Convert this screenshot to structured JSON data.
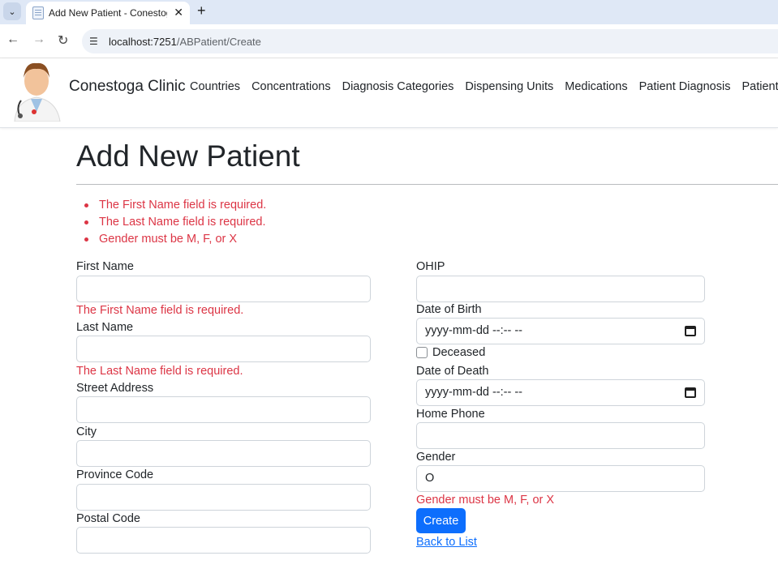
{
  "browser": {
    "tab_title": "Add New Patient - Conestoga C",
    "url_host": "localhost:7251",
    "url_path": "/ABPatient/Create"
  },
  "navbar": {
    "brand": "Conestoga Clinic",
    "links": [
      "Countries",
      "Concentrations",
      "Diagnosis Categories",
      "Dispensing Units",
      "Medications",
      "Patient Diagnosis",
      "Patients"
    ]
  },
  "page": {
    "title": "Add New Patient",
    "summary_errors": [
      "The First Name field is required.",
      "The Last Name field is required.",
      "Gender must be M, F, or X"
    ]
  },
  "form": {
    "first_name": {
      "label": "First Name",
      "value": "",
      "error": "The First Name field is required."
    },
    "last_name": {
      "label": "Last Name",
      "value": "",
      "error": "The Last Name field is required."
    },
    "street_address": {
      "label": "Street Address",
      "value": ""
    },
    "city": {
      "label": "City",
      "value": ""
    },
    "province_code": {
      "label": "Province Code",
      "value": ""
    },
    "postal_code": {
      "label": "Postal Code",
      "value": ""
    },
    "ohip": {
      "label": "OHIP",
      "value": ""
    },
    "date_of_birth": {
      "label": "Date of Birth",
      "value": "yyyy-mm-dd --:-- --"
    },
    "deceased": {
      "label": "Deceased",
      "checked": false
    },
    "date_of_death": {
      "label": "Date of Death",
      "value": "yyyy-mm-dd --:-- --"
    },
    "home_phone": {
      "label": "Home Phone",
      "value": ""
    },
    "gender": {
      "label": "Gender",
      "value": "O",
      "error": "Gender must be M, F, or X"
    },
    "create_label": "Create",
    "back_label": "Back to List"
  },
  "colors": {
    "accent": "#0d6efd",
    "error": "#dc3545",
    "tabstrip": "#dfe8f6"
  }
}
